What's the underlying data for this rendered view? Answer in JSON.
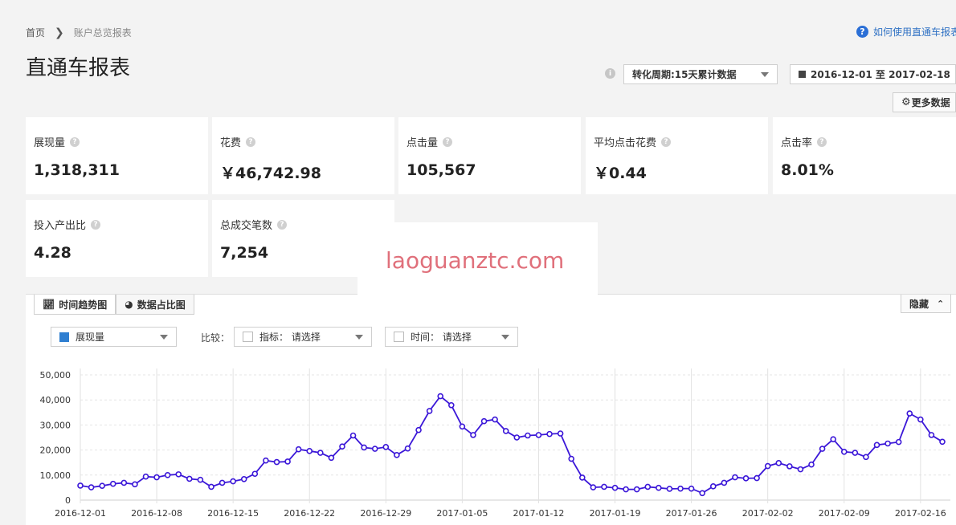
{
  "breadcrumb": {
    "home": "首页",
    "separator": "›",
    "current": "账户总览报表"
  },
  "help_link": {
    "label": "如何使用直通车报表"
  },
  "page_title": "直通车报表",
  "period_select": {
    "value": "转化周期:15天累计数据"
  },
  "date_range": {
    "value": "2016-12-01 至 2017-02-18"
  },
  "more_data_button": {
    "label": "更多数据"
  },
  "kpis": [
    {
      "label": "展现量",
      "value": "1,318,311"
    },
    {
      "label": "花费",
      "value": "￥46,742.98"
    },
    {
      "label": "点击量",
      "value": "105,567"
    },
    {
      "label": "平均点击花费",
      "value": "￥0.44"
    },
    {
      "label": "点击率",
      "value": "8.01%"
    },
    {
      "label": "投入产出比",
      "value": "4.28"
    },
    {
      "label": "总成交笔数",
      "value": "7,254"
    }
  ],
  "watermark": {
    "text": "laoguanztc.com"
  },
  "tabs": [
    {
      "label": "时间趋势图",
      "icon": "line-chart-icon"
    },
    {
      "label": "数据占比图",
      "icon": "pie-chart-icon"
    }
  ],
  "hide_button": {
    "label": "隐藏"
  },
  "metric_select": {
    "value": "展现量",
    "color": "#2f7fd1"
  },
  "compare": {
    "label": "比较：",
    "indicator": "指标：  请选择",
    "time": "时间：  请选择"
  },
  "chart_data": {
    "type": "line",
    "series_color": "#3b17d8",
    "ylim": [
      0,
      50000
    ],
    "y_ticks": [
      "0",
      "10,000",
      "20,000",
      "30,000",
      "40,000",
      "50,000"
    ],
    "x_tick_labels": [
      "2016-12-01",
      "2016-12-08",
      "2016-12-15",
      "2016-12-22",
      "2016-12-29",
      "2017-01-05",
      "2017-01-12",
      "2017-01-19",
      "2017-01-26",
      "2017-02-02",
      "2017-02-09",
      "2017-02-16"
    ],
    "x_start": "2016-12-01",
    "values": [
      5800,
      5100,
      5700,
      6500,
      6900,
      6300,
      9400,
      9100,
      10000,
      10300,
      8500,
      8100,
      5300,
      6900,
      7500,
      8400,
      10500,
      15800,
      15200,
      15400,
      20300,
      19600,
      18900,
      16900,
      21400,
      25800,
      21000,
      20500,
      21200,
      18000,
      20600,
      28000,
      35600,
      41500,
      37900,
      29400,
      26000,
      31500,
      32200,
      27600,
      25000,
      25800,
      26000,
      26400,
      26600,
      16500,
      9000,
      5100,
      5300,
      4900,
      4300,
      4300,
      5300,
      4900,
      4500,
      4600,
      4600,
      2800,
      5500,
      6900,
      9100,
      8700,
      8800,
      13600,
      14800,
      13500,
      12300,
      14200,
      20500,
      24300,
      19300,
      18900,
      17200,
      22000,
      22600,
      23200,
      34600,
      32200,
      26000,
      23300
    ]
  }
}
